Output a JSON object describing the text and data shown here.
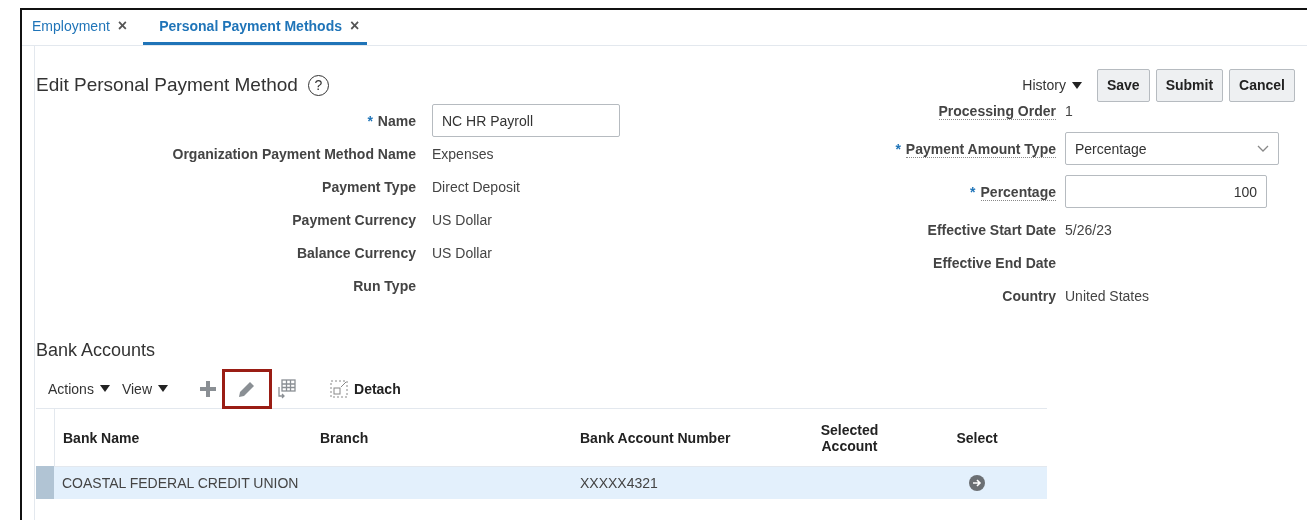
{
  "tabs": [
    {
      "label": "Employment",
      "selected": false,
      "close": "×"
    },
    {
      "label": "Personal Payment Methods",
      "selected": true,
      "close": "×"
    }
  ],
  "page": {
    "title": "Edit Personal Payment Method",
    "help": "?"
  },
  "header_actions": {
    "menu": "History",
    "buttons": [
      "Save",
      "Submit",
      "Cancel"
    ]
  },
  "left_fields": [
    {
      "label": "Name",
      "required_mark": "*",
      "kind": "input",
      "value": "NC HR Payroll"
    },
    {
      "label": "Organization Payment Method Name",
      "kind": "text",
      "value": "Expenses"
    },
    {
      "label": "Payment Type",
      "kind": "text",
      "value": "Direct Deposit"
    },
    {
      "label": "Payment Currency",
      "kind": "text",
      "value": "US Dollar"
    },
    {
      "label": "Balance Currency",
      "kind": "text",
      "value": "US Dollar"
    },
    {
      "label": "Run Type",
      "kind": "text"
    }
  ],
  "right_fields": [
    {
      "label": "Processing Order",
      "kind": "text",
      "value": "1",
      "link": true
    },
    {
      "label": "Payment Amount Type",
      "required_mark": "*",
      "kind": "select",
      "value": "Percentage",
      "link": true
    },
    {
      "label": "Percentage",
      "required_mark": "*",
      "kind": "number",
      "value": "100",
      "link": true
    },
    {
      "label": "Effective Start Date",
      "kind": "text",
      "value": "5/26/23",
      "link": false
    },
    {
      "label": "Effective End Date",
      "kind": "text",
      "link": false
    },
    {
      "label": "Country",
      "kind": "text",
      "value": "United States",
      "link": false
    }
  ],
  "bank_accounts": {
    "title": "Bank Accounts",
    "menus": [
      "Actions",
      "View"
    ],
    "tools": [
      {
        "kind": "add",
        "highlighted": false
      },
      {
        "kind": "edit",
        "highlighted": true
      },
      {
        "kind": "freeze",
        "highlighted": false
      }
    ],
    "detach": "Detach",
    "table": {
      "columns": [
        "Bank Name",
        "Branch",
        "Bank Account Number",
        "Selected Account",
        "Select"
      ],
      "rows": [
        {
          "selected": true,
          "bank_name": "COASTAL FEDERAL CREDIT UNION",
          "bank_account_number": "XXXXX4321"
        }
      ]
    }
  }
}
